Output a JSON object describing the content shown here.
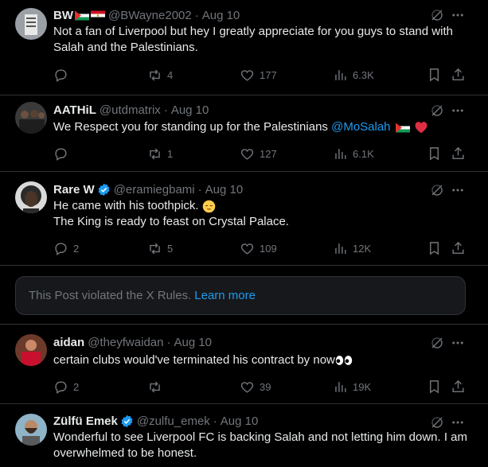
{
  "posts": [
    {
      "name": "BW",
      "handle": "@BWayne2002",
      "date": "Aug 10",
      "text": "Not a fan of Liverpool but hey I greatly appreciate for you guys to stand with Salah and the Palestinians.",
      "replies": "",
      "reposts": "4",
      "likes": "177",
      "views": "6.3K",
      "flags": [
        "palestine-flag",
        "egypt-flag"
      ]
    },
    {
      "name": "AATHiL",
      "handle": "@utdmatrix",
      "date": "Aug 10",
      "text": "We Respect you for standing up for the Palestinians ",
      "mention": "@MoSalah",
      "replies": "",
      "reposts": "1",
      "likes": "127",
      "views": "6.1K",
      "emoji": [
        "palestine-flag",
        "red-heart"
      ]
    },
    {
      "name": "Rare W",
      "handle": "@eramiegbami",
      "date": "Aug 10",
      "verified": true,
      "text_line1": "He came with his toothpick. ",
      "text_line2": "The King is ready to feast on Crystal Palace.",
      "replies": "2",
      "reposts": "5",
      "likes": "109",
      "views": "12K",
      "emoji": [
        "relieved-face"
      ]
    },
    {
      "name": "aidan",
      "handle": "@theyfwaidan",
      "date": "Aug 10",
      "text": "certain clubs would've terminated his contract by now",
      "replies": "2",
      "reposts": "",
      "likes": "39",
      "views": "19K",
      "emoji": [
        "eyes"
      ]
    },
    {
      "name": "Zülfü Emek",
      "handle": "@zulfu_emek",
      "date": "Aug 10",
      "verified": true,
      "text": "Wonderful to see Liverpool FC is backing Salah and not letting him down. I am overwhelmed to be honest."
    }
  ],
  "violation": {
    "text": "This Post violated the X Rules.",
    "link": "Learn more"
  },
  "sep": "·",
  "colors": {
    "background": "#000000",
    "accent": "#1d9bf0",
    "muted": "#71767b",
    "border": "#2f3336"
  }
}
